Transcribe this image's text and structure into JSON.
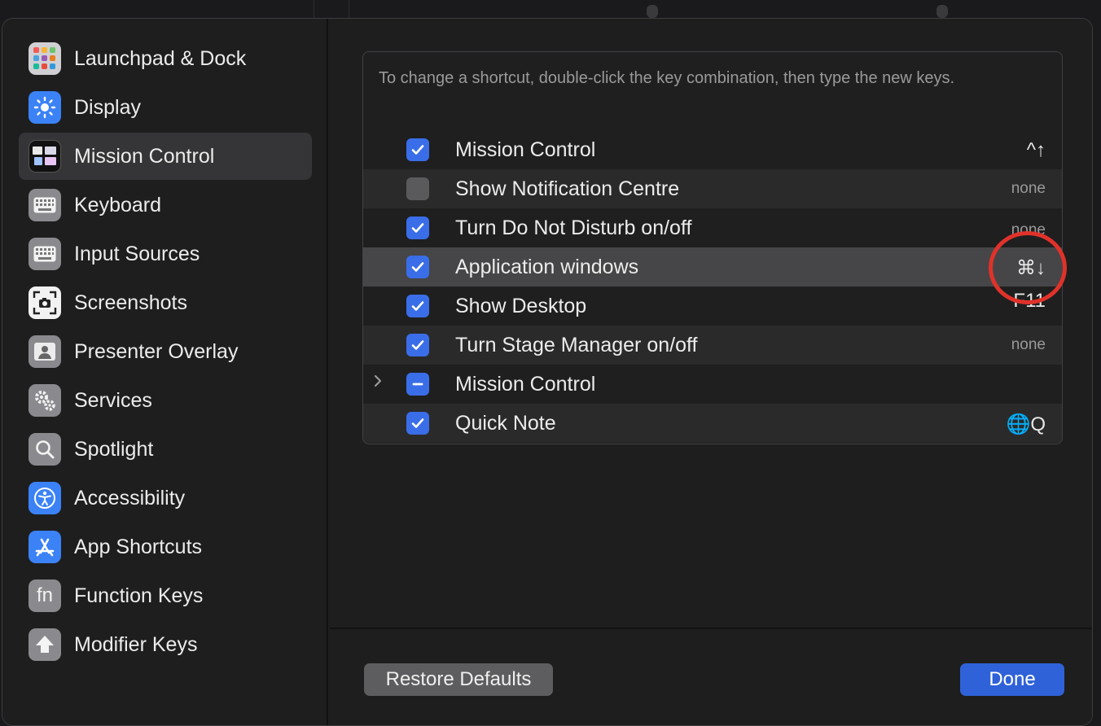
{
  "sidebar": {
    "items": [
      {
        "label": "Launchpad & Dock",
        "icon": "launchpad-icon",
        "selected": false
      },
      {
        "label": "Display",
        "icon": "display-icon",
        "selected": false
      },
      {
        "label": "Mission Control",
        "icon": "mission-control-icon",
        "selected": true
      },
      {
        "label": "Keyboard",
        "icon": "keyboard-icon",
        "selected": false
      },
      {
        "label": "Input Sources",
        "icon": "input-sources-icon",
        "selected": false
      },
      {
        "label": "Screenshots",
        "icon": "screenshots-icon",
        "selected": false
      },
      {
        "label": "Presenter Overlay",
        "icon": "presenter-overlay-icon",
        "selected": false
      },
      {
        "label": "Services",
        "icon": "services-icon",
        "selected": false
      },
      {
        "label": "Spotlight",
        "icon": "spotlight-icon",
        "selected": false
      },
      {
        "label": "Accessibility",
        "icon": "accessibility-icon",
        "selected": false
      },
      {
        "label": "App Shortcuts",
        "icon": "app-shortcuts-icon",
        "selected": false
      },
      {
        "label": "Function Keys",
        "icon": "function-keys-icon",
        "selected": false
      },
      {
        "label": "Modifier Keys",
        "icon": "modifier-keys-icon",
        "selected": false
      }
    ],
    "function_keys_glyph": "fn"
  },
  "panel": {
    "hint": "To change a shortcut, double-click the key combination, then type the new keys.",
    "rows": [
      {
        "label": "Mission Control",
        "state": "checked",
        "shortcut": "^↑"
      },
      {
        "label": "Show Notification Centre",
        "state": "unchecked",
        "shortcut": "none"
      },
      {
        "label": "Turn Do Not Disturb on/off",
        "state": "checked",
        "shortcut": "none"
      },
      {
        "label": "Application windows",
        "state": "checked",
        "shortcut": "⌘↓",
        "highlighted": true
      },
      {
        "label": "Show Desktop",
        "state": "checked",
        "shortcut": "F11"
      },
      {
        "label": "Turn Stage Manager on/off",
        "state": "checked",
        "shortcut": "none"
      },
      {
        "label": "Mission Control",
        "state": "mixed",
        "shortcut": "",
        "expandable": true
      },
      {
        "label": "Quick Note",
        "state": "checked",
        "shortcut": "🌐Q"
      }
    ]
  },
  "buttons": {
    "restore_defaults": "Restore Defaults",
    "done": "Done"
  },
  "colors": {
    "accent": "#3a6ee8",
    "annotation_circle": "#e0322a"
  }
}
